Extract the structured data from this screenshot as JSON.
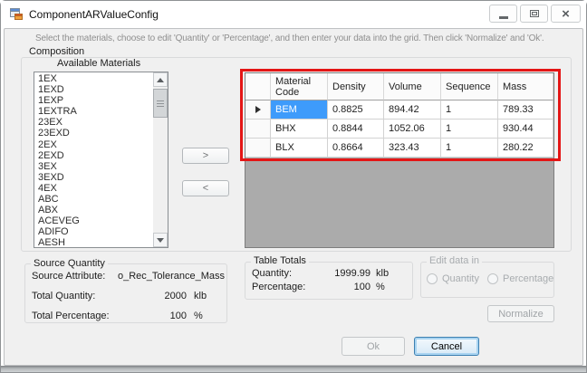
{
  "window": {
    "title": "ComponentARValueConfig"
  },
  "instruction": "Select the materials, choose to edit 'Quantity' or 'Percentage', and then enter your data into the grid. Then click 'Normalize' and 'Ok'.",
  "composition": {
    "label": "Composition",
    "available_materials": {
      "label": "Available Materials",
      "items": [
        "1EX",
        "1EXD",
        "1EXP",
        "1EXTRA",
        "23EX",
        "23EXD",
        "2EX",
        "2EXD",
        "3EX",
        "3EXD",
        "4EX",
        "ABC",
        "ABX",
        "ACEVEG",
        "ADIFO",
        "AESH"
      ]
    },
    "move_right": ">",
    "move_left": "<",
    "grid": {
      "columns": [
        "Material Code",
        "Density",
        "Volume",
        "Sequence",
        "Mass"
      ],
      "rows": [
        [
          "BEM",
          "0.8825",
          "894.42",
          "1",
          "789.33"
        ],
        [
          "BHX",
          "0.8844",
          "1052.06",
          "1",
          "930.44"
        ],
        [
          "BLX",
          "0.8664",
          "323.43",
          "1",
          "280.22"
        ]
      ],
      "selected_row": 0,
      "selected_cell": "BEM"
    }
  },
  "source_quantity": {
    "label": "Source Quantity",
    "source_attribute_label": "Source Attribute:",
    "source_attribute_value": "o_Rec_Tolerance_Mass",
    "total_quantity_label": "Total Quantity:",
    "total_quantity_value": "2000",
    "total_quantity_unit": "klb",
    "total_percentage_label": "Total Percentage:",
    "total_percentage_value": "100",
    "total_percentage_unit": "%"
  },
  "table_totals": {
    "label": "Table Totals",
    "quantity_label": "Quantity:",
    "quantity_value": "1999.99",
    "quantity_unit": "klb",
    "percentage_label": "Percentage:",
    "percentage_value": "100",
    "percentage_unit": "%"
  },
  "edit_data_in": {
    "label": "Edit data in",
    "options": [
      "Quantity",
      "Percentage"
    ]
  },
  "buttons": {
    "normalize": "Normalize",
    "ok": "Ok",
    "cancel": "Cancel"
  },
  "colors": {
    "annotation_red": "#e41616",
    "selection_blue": "#3e9bfb",
    "grid_empty_background": "#ababab",
    "client_background": "#f0f0f0"
  }
}
